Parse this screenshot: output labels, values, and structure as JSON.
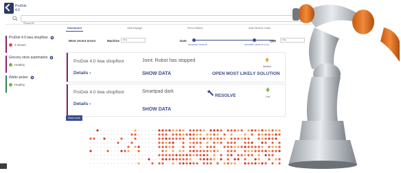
{
  "header": {
    "logo_text": "ProDok\n4.0",
    "search_placeholder": "Search",
    "tabs": [
      {
        "label": "Dashboard",
        "active": true
      },
      {
        "label": "Searchpage",
        "active": false
      },
      {
        "label": "Error History",
        "active": false
      },
      {
        "label": "Add Service Case",
        "active": false
      }
    ]
  },
  "sidebar": {
    "items": [
      {
        "title": "ProDok 4.0 iiwa shopfloor",
        "status": "2 Issues",
        "bar_color": "#8e1e6b",
        "dot_color": "#d9534f"
      },
      {
        "title": "Grocery store automation",
        "status": "Healthy",
        "bar_color": "#8e1e6b",
        "dot_color": "#7cb342"
      },
      {
        "title": "Wafer picker",
        "status": "Healthy",
        "bar_color": "#2e7d5b",
        "dot_color": "#7cb342"
      }
    ]
  },
  "filters": {
    "title": "Most recent errors",
    "machine_label": "Machine",
    "machine_value": "Any",
    "date_label": "Date",
    "date_start": "18/12/2017 18:00:06",
    "date_end": "18/12/2017 18:00:37 (now)",
    "type_label": "Type",
    "type_value": "Any"
  },
  "errors": [
    {
      "machine": "ProDok 4.0 iiwa shopfloor",
      "details": "Details",
      "message": "Joint: Robot has stopped",
      "show_data": "SHOW DATA",
      "action": "OPEN MOST LIKELY SOLUTION",
      "severity": "Medium",
      "severity_color": "#f0a030"
    },
    {
      "machine": "ProDok 4.0 iiwa shopfloor",
      "details": "Details",
      "message": "Smartpad dark",
      "show_data": "SHOW DATA",
      "action": "RESOLVE",
      "severity": "Low",
      "severity_color": "#7cb342"
    }
  ],
  "show_more_label": "Show more",
  "colors": {
    "accent": "#3a4a8c",
    "sidebar_bar": "#8e1e6b",
    "robot_orange": "#e8701a"
  }
}
